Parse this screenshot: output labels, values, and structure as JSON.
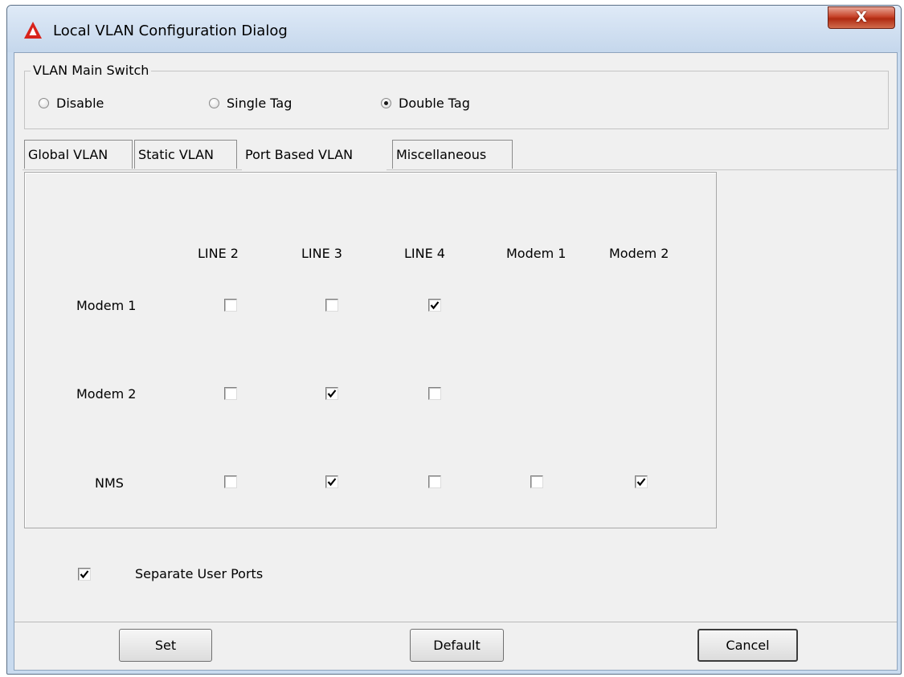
{
  "window": {
    "title": "Local VLAN Configuration Dialog",
    "close_glyph": "X"
  },
  "main_switch": {
    "title": "VLAN Main Switch",
    "options": [
      {
        "label": "Disable",
        "selected": false
      },
      {
        "label": "Single Tag",
        "selected": false
      },
      {
        "label": "Double Tag",
        "selected": true
      }
    ]
  },
  "tabs": [
    {
      "label": "Global VLAN",
      "active": false
    },
    {
      "label": "Static VLAN",
      "active": false
    },
    {
      "label": "Port Based VLAN",
      "active": true
    },
    {
      "label": "Miscellaneous",
      "active": false
    }
  ],
  "matrix": {
    "columns": [
      "LINE 2",
      "LINE 3",
      "LINE 4",
      "Modem 1",
      "Modem 2"
    ],
    "rows": [
      {
        "label": "Modem 1",
        "cells": [
          false,
          false,
          true
        ]
      },
      {
        "label": "Modem 2",
        "cells": [
          false,
          true,
          false
        ]
      },
      {
        "label": "NMS",
        "cells": [
          false,
          true,
          false,
          false,
          true
        ]
      }
    ]
  },
  "separate_user_ports": {
    "label": "Separate User Ports",
    "checked": true
  },
  "buttons": {
    "set": "Set",
    "default": "Default",
    "cancel": "Cancel"
  },
  "icons": {
    "app_logo": "warning-triangle-icon",
    "close": "close-icon",
    "radio": "radio-button",
    "checkbox": "checkmark-icon"
  },
  "colors": {
    "window_frame": "#c9dbef",
    "client_background": "#f0f0f0",
    "close_button": "#c7432a",
    "logo_red": "#d8231b"
  }
}
